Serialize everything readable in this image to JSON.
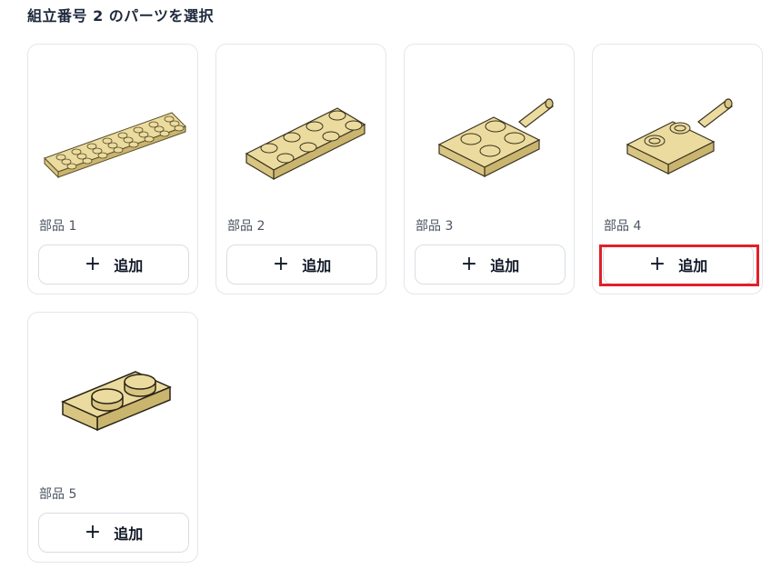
{
  "header": {
    "title": "組立番号 2 のパーツを選択"
  },
  "parts": [
    {
      "label": "部品 1",
      "button_label": "追加",
      "button_icon": "plus-icon"
    },
    {
      "label": "部品 2",
      "button_label": "追加",
      "button_icon": "plus-icon"
    },
    {
      "label": "部品 3",
      "button_label": "追加",
      "button_icon": "plus-icon"
    },
    {
      "label": "部品 4",
      "button_label": "追加",
      "button_icon": "plus-icon"
    },
    {
      "label": "部品 5",
      "button_label": "追加",
      "button_icon": "plus-icon"
    }
  ],
  "colors": {
    "brick_fill": "#EBDB9E",
    "brick_dark": "#C9B56E",
    "outline": "#2f2a1a",
    "highlight": "#E0202A"
  }
}
